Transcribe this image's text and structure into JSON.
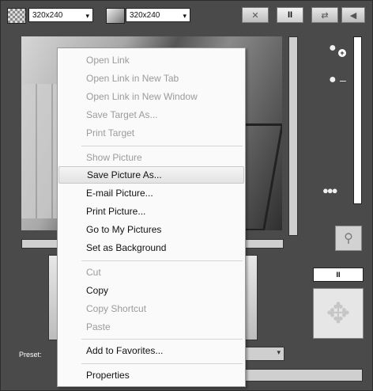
{
  "toolbar": {
    "resolution_1": "320x240",
    "resolution_2": "320x240",
    "pause_label": "II",
    "select_arrow": "▾"
  },
  "side": {
    "pause_label": "II"
  },
  "bottom": {
    "preset_label": "Preset:"
  },
  "context_menu": {
    "open_link": "Open Link",
    "open_link_new_tab": "Open Link in New Tab",
    "open_link_new_window": "Open Link in New Window",
    "save_target_as": "Save Target As...",
    "print_target": "Print Target",
    "show_picture": "Show Picture",
    "save_picture_as": "Save Picture As...",
    "email_picture": "E-mail Picture...",
    "print_picture": "Print Picture...",
    "go_to_my_pictures": "Go to My Pictures",
    "set_as_background": "Set as Background",
    "cut": "Cut",
    "copy": "Copy",
    "copy_shortcut": "Copy Shortcut",
    "paste": "Paste",
    "add_to_favorites": "Add to Favorites...",
    "properties": "Properties"
  },
  "icons": {
    "fit": "✕",
    "swap": "⇄",
    "volume": "◀",
    "zoom": "●",
    "picture": "⚲",
    "ptz": "✥"
  },
  "colors": {
    "background": "#4a4a4a",
    "menu_background": "#fafafa",
    "disabled_text": "#9b9b9b"
  }
}
